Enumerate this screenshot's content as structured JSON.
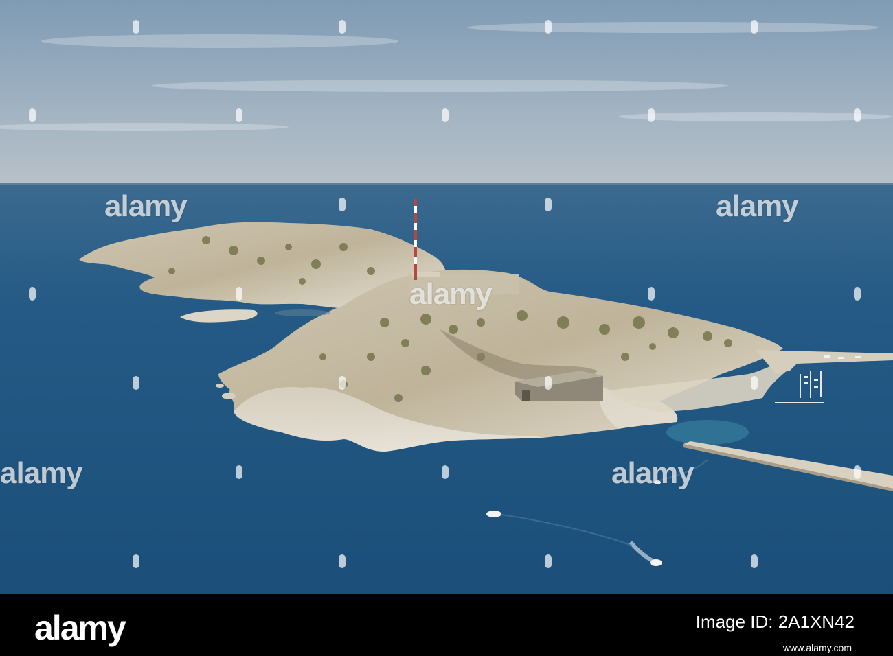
{
  "photo": {
    "description_hidden": "",
    "sky_color": "#8fa6bb",
    "sea_color": "#1f5a86",
    "rock_color": "#d8d0bf",
    "vegetation_color": "#6e7044"
  },
  "watermark": {
    "text": "alamy"
  },
  "footer": {
    "logo": "alamy",
    "image_id_label": "Image ID: 2A1XN42",
    "url": "www.alamy.com"
  }
}
